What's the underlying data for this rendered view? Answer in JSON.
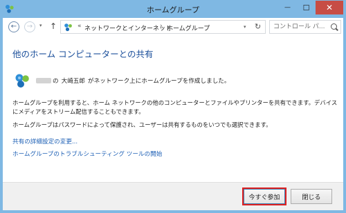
{
  "window": {
    "title": "ホームグループ",
    "close_glyph": "✕",
    "minimize_glyph": "—",
    "maximize_glyph": "☐"
  },
  "nav": {
    "back_glyph": "←",
    "forward_glyph": "→",
    "up_glyph": "↑",
    "dropdown_glyph": "▾",
    "refresh_glyph": "↻",
    "breadcrumb_sep": "«",
    "crumb_sep": "›",
    "breadcrumbs": [
      "ネットワークとインターネット",
      "ホームグループ"
    ],
    "search_placeholder": "コントロール パ..."
  },
  "main": {
    "heading": "他のホーム コンピューターとの共有",
    "owner_name": "大崎五郎",
    "owner_pre": "の",
    "owner_post": "がネットワーク上にホームグループを作成しました。",
    "paragraph1": "ホームグループを利用すると、ホーム ネットワークの他のコンピューターとファイルやプリンターを共有できます。デバイスにメディアをストリーム配信することもできます。",
    "paragraph2": "ホームグループはパスワードによって保護され、ユーザーは共有するものをいつでも選択できます。",
    "link_advanced": "共有の詳細設定の変更...",
    "link_troubleshoot": "ホームグループのトラブルシューティング ツールの開始"
  },
  "footer": {
    "join_label": "今すぐ参加",
    "close_label": "閉じる"
  },
  "colors": {
    "frame": "#7fb8e3",
    "heading": "#1a4e9a",
    "link": "#1c5fb5",
    "close_button": "#c74d45",
    "highlight": "#e02020"
  }
}
